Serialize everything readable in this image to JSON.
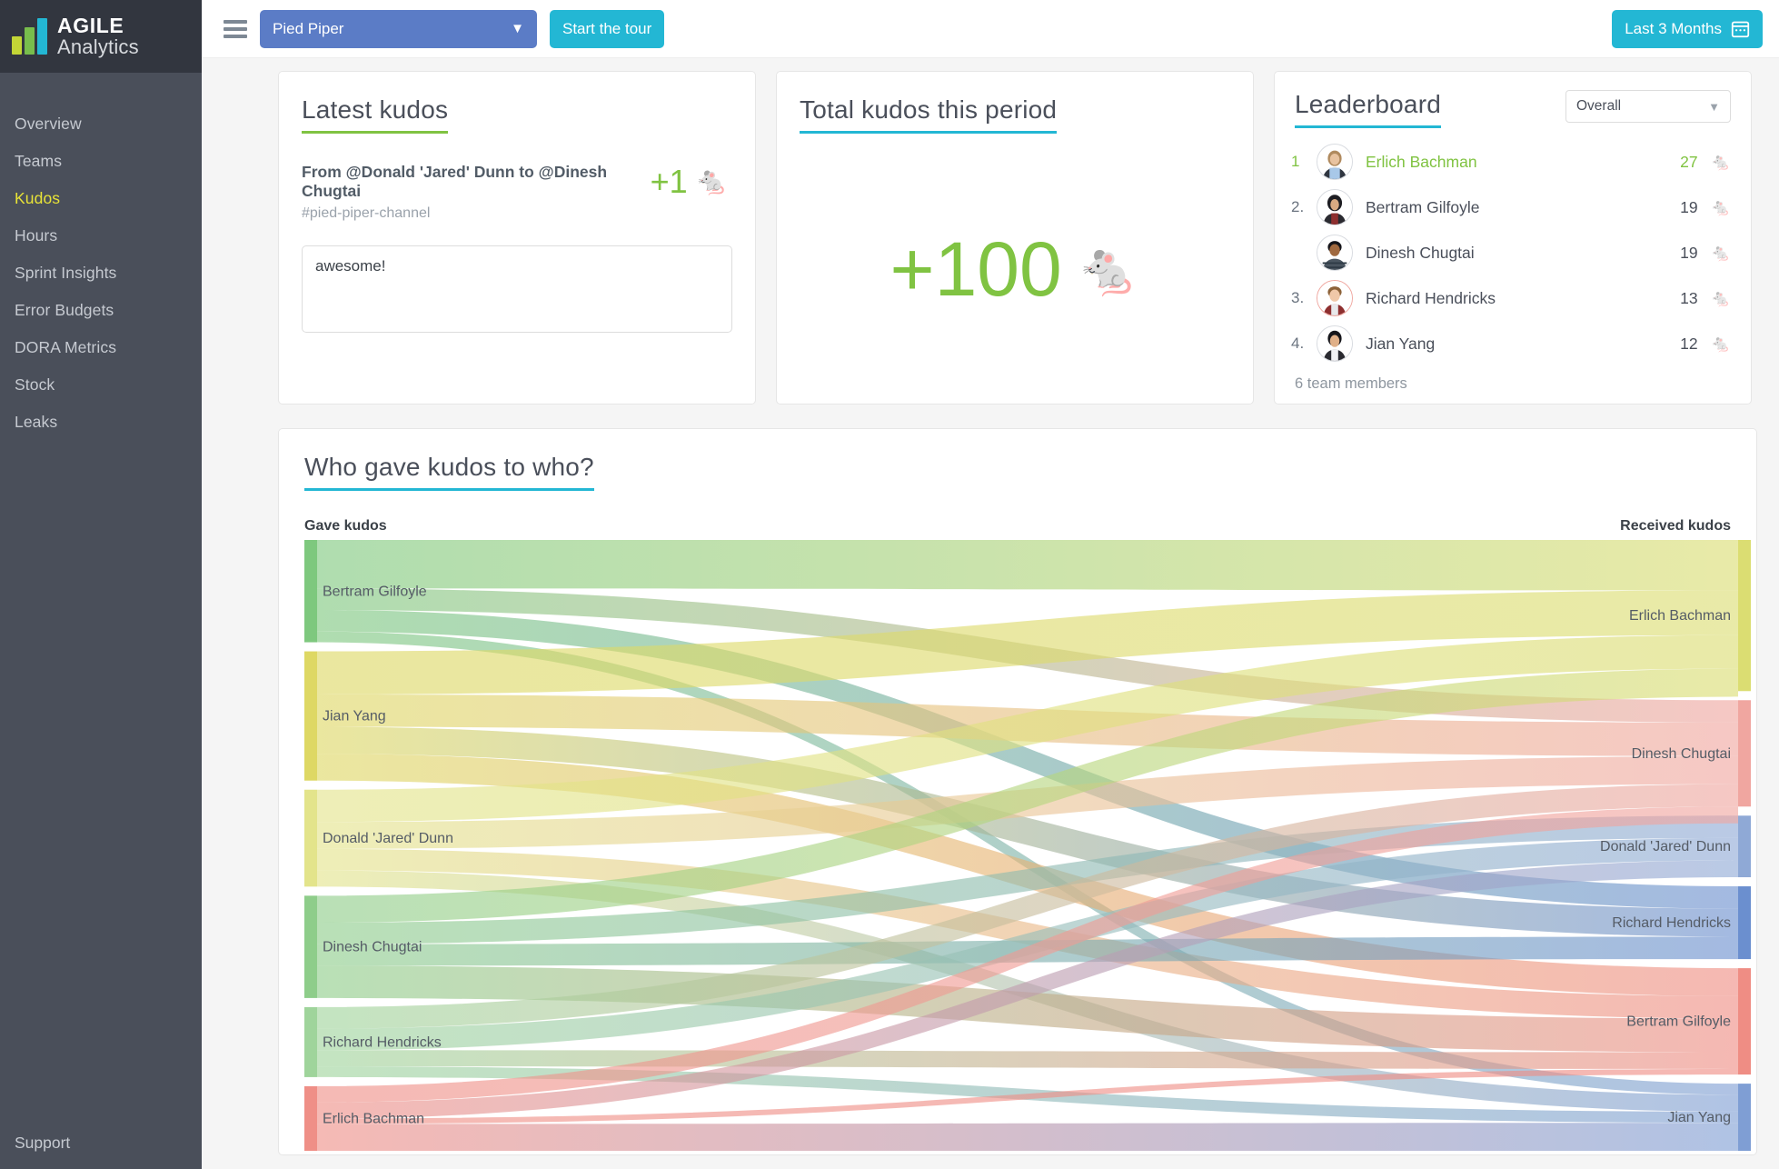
{
  "brand": {
    "line1": "AGILE",
    "line2": "Analytics",
    "colors": [
      "#c3d636",
      "#78bd4c",
      "#23b7d4"
    ]
  },
  "sidebar": {
    "items": [
      {
        "label": "Overview",
        "active": false
      },
      {
        "label": "Teams",
        "active": false
      },
      {
        "label": "Kudos",
        "active": true
      },
      {
        "label": "Hours",
        "active": false
      },
      {
        "label": "Sprint Insights",
        "active": false
      },
      {
        "label": "Error Budgets",
        "active": false
      },
      {
        "label": "DORA Metrics",
        "active": false
      },
      {
        "label": "Stock",
        "active": false
      },
      {
        "label": "Leaks",
        "active": false
      }
    ],
    "support_label": "Support",
    "active_color": "#e8e337"
  },
  "topbar": {
    "team_select_value": "Pied Piper",
    "tour_button_label": "Start the tour",
    "date_range_label": "Last 3 Months",
    "accent_blue": "#5b7cc6",
    "accent_cyan": "#23b7d4"
  },
  "latest_kudos": {
    "title": "Latest kudos",
    "from_to": "From @Donald 'Jared' Dunn to @Dinesh Chugtai",
    "channel": "#pied-piper-channel",
    "amount": "+1",
    "emoji": "🐁",
    "message": "awesome!"
  },
  "total_kudos": {
    "title": "Total kudos this period",
    "value": "+100",
    "emoji": "🐁"
  },
  "leaderboard": {
    "title": "Leaderboard",
    "filter_value": "Overall",
    "footer": "6 team members",
    "rows": [
      {
        "rank": "1",
        "name": "Erlich Bachman",
        "score": "27",
        "highlight": true
      },
      {
        "rank": "2.",
        "name": "Bertram Gilfoyle",
        "score": "19",
        "highlight": false
      },
      {
        "rank": "",
        "name": "Dinesh Chugtai",
        "score": "19",
        "highlight": false
      },
      {
        "rank": "3.",
        "name": "Richard Hendricks",
        "score": "13",
        "highlight": false
      },
      {
        "rank": "4.",
        "name": "Jian Yang",
        "score": "12",
        "highlight": false
      }
    ]
  },
  "sankey_card": {
    "title": "Who gave kudos to who?",
    "left_legend": "Gave kudos",
    "right_legend": "Received kudos"
  },
  "chart_data": {
    "type": "sankey",
    "title": "Who gave kudos to who?",
    "left_axis_label": "Gave kudos",
    "right_axis_label": "Received kudos",
    "source_nodes": [
      {
        "name": "Bertram Gilfoyle",
        "value": 19,
        "color": "#7ec87e"
      },
      {
        "name": "Jian Yang",
        "value": 24,
        "color": "#ded864"
      },
      {
        "name": "Donald 'Jared' Dunn",
        "value": 18,
        "color": "#e3e48b"
      },
      {
        "name": "Dinesh Chugtai",
        "value": 19,
        "color": "#8ecd8a"
      },
      {
        "name": "Richard Hendricks",
        "value": 13,
        "color": "#9fd49b"
      },
      {
        "name": "Erlich Bachman",
        "value": 12,
        "color": "#ef8f87"
      }
    ],
    "target_nodes": [
      {
        "name": "Erlich Bachman",
        "value": 27,
        "color": "#dbdd72"
      },
      {
        "name": "Dinesh Chugtai",
        "value": 19,
        "color": "#f0a6a0"
      },
      {
        "name": "Donald 'Jared' Dunn",
        "value": 11,
        "color": "#8fa9d6"
      },
      {
        "name": "Richard Hendricks",
        "value": 13,
        "color": "#6b8fcf"
      },
      {
        "name": "Bertram Gilfoyle",
        "value": 19,
        "color": "#ef8d84"
      },
      {
        "name": "Jian Yang",
        "value": 12,
        "color": "#7f9ed4"
      }
    ],
    "links": [
      {
        "source": "Bertram Gilfoyle",
        "target": "Erlich Bachman",
        "value": 9
      },
      {
        "source": "Bertram Gilfoyle",
        "target": "Dinesh Chugtai",
        "value": 4
      },
      {
        "source": "Bertram Gilfoyle",
        "target": "Richard Hendricks",
        "value": 4
      },
      {
        "source": "Bertram Gilfoyle",
        "target": "Jian Yang",
        "value": 2
      },
      {
        "source": "Jian Yang",
        "target": "Erlich Bachman",
        "value": 8
      },
      {
        "source": "Jian Yang",
        "target": "Dinesh Chugtai",
        "value": 6
      },
      {
        "source": "Jian Yang",
        "target": "Bertram Gilfoyle",
        "value": 5
      },
      {
        "source": "Jian Yang",
        "target": "Richard Hendricks",
        "value": 5
      },
      {
        "source": "Donald 'Jared' Dunn",
        "target": "Erlich Bachman",
        "value": 6
      },
      {
        "source": "Donald 'Jared' Dunn",
        "target": "Dinesh Chugtai",
        "value": 5
      },
      {
        "source": "Donald 'Jared' Dunn",
        "target": "Bertram Gilfoyle",
        "value": 4
      },
      {
        "source": "Donald 'Jared' Dunn",
        "target": "Jian Yang",
        "value": 3
      },
      {
        "source": "Dinesh Chugtai",
        "target": "Erlich Bachman",
        "value": 5
      },
      {
        "source": "Dinesh Chugtai",
        "target": "Donald 'Jared' Dunn",
        "value": 4
      },
      {
        "source": "Dinesh Chugtai",
        "target": "Richard Hendricks",
        "value": 4
      },
      {
        "source": "Dinesh Chugtai",
        "target": "Bertram Gilfoyle",
        "value": 6
      },
      {
        "source": "Richard Hendricks",
        "target": "Dinesh Chugtai",
        "value": 4
      },
      {
        "source": "Richard Hendricks",
        "target": "Donald 'Jared' Dunn",
        "value": 4
      },
      {
        "source": "Richard Hendricks",
        "target": "Bertram Gilfoyle",
        "value": 3
      },
      {
        "source": "Richard Hendricks",
        "target": "Jian Yang",
        "value": 2
      },
      {
        "source": "Erlich Bachman",
        "target": "Bertram Gilfoyle",
        "value": 1
      },
      {
        "source": "Erlich Bachman",
        "target": "Donald 'Jared' Dunn",
        "value": 3
      },
      {
        "source": "Erlich Bachman",
        "target": "Jian Yang",
        "value": 5
      },
      {
        "source": "Erlich Bachman",
        "target": "Dinesh Chugtai",
        "value": 3
      }
    ]
  }
}
